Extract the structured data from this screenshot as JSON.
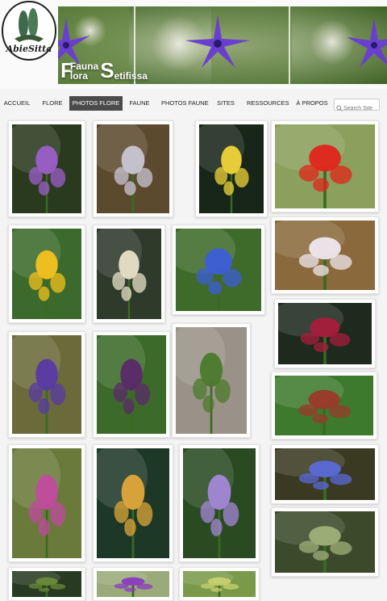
{
  "site": {
    "logo_text": "AbieSitta",
    "title_first_big": "F",
    "title_fauna": "Fauna",
    "title_flora": "lora",
    "title_second_big": "S",
    "title_setifissa": "etifissa"
  },
  "nav": {
    "items": [
      {
        "label": "ACCUEIL"
      },
      {
        "label": "FLORE"
      },
      {
        "label": "PHOTOS FLORE"
      },
      {
        "label": "FAUNE"
      },
      {
        "label": "PHOTOS FAUNE"
      },
      {
        "label": "SITES"
      },
      {
        "label": "RESSOURCES"
      },
      {
        "label": "À PROPOS"
      }
    ],
    "active_index": 2
  },
  "search": {
    "placeholder": "Search Site"
  },
  "colors": {
    "nav_active_bg": "#4b4b4b",
    "banner_green": "#4a6b2c",
    "flower_violet": "#6a3fd0"
  },
  "gallery": {
    "photos": [
      {
        "subject": "ophrys-orchid",
        "bg": "#2a3a1e",
        "accent": "#9b5fc9"
      },
      {
        "subject": "white-bud",
        "bg": "#5c4a2e",
        "accent": "#c9c6d4"
      },
      {
        "subject": "yellow-narcissus",
        "bg": "#18261a",
        "accent": "#f0d43a"
      },
      {
        "subject": "red-poppy",
        "bg": "#8aa05c",
        "accent": "#e0251a"
      },
      {
        "subject": "yellow-daisy",
        "bg": "#3c6a2c",
        "accent": "#f4c21e"
      },
      {
        "subject": "pale-bells",
        "bg": "#2e3a2a",
        "accent": "#e8e2c8"
      },
      {
        "subject": "blue-pimpernel",
        "bg": "#3e6a2a",
        "accent": "#3c5ed8"
      },
      {
        "subject": "white-papery",
        "bg": "#8a6a3c",
        "accent": "#efe7ee"
      },
      {
        "subject": "purple-sage",
        "bg": "#6a6a3a",
        "accent": "#5a3aa6"
      },
      {
        "subject": "purple-spikes",
        "bg": "#3c6a2a",
        "accent": "#5a2a6a"
      },
      {
        "subject": "orchid-in-leaves",
        "bg": "#9a9288",
        "accent": "#4a7a2a"
      },
      {
        "subject": "dark-red-berries",
        "bg": "#1e2a1e",
        "accent": "#a81e3c"
      },
      {
        "subject": "green-leaves-pod",
        "bg": "#3e7a2e",
        "accent": "#9a3a2a"
      },
      {
        "subject": "pink-orchid",
        "bg": "#6a7a3a",
        "accent": "#c24aa0"
      },
      {
        "subject": "yellow-orchid-stalk",
        "bg": "#1e3828",
        "accent": "#e0a63a"
      },
      {
        "subject": "lilac-flowers",
        "bg": "#2a4a22",
        "accent": "#a487d8"
      },
      {
        "subject": "blue-globes",
        "bg": "#3a3a22",
        "accent": "#5a6ad8"
      },
      {
        "subject": "cedar-cone",
        "bg": "#3a4a2a",
        "accent": "#a0b07a"
      },
      {
        "subject": "row5-left",
        "bg": "#283a22",
        "accent": "#6a8a3a"
      },
      {
        "subject": "row5-mid",
        "bg": "#9aaa7a",
        "accent": "#8a3ac0"
      },
      {
        "subject": "row5-right",
        "bg": "#7a9a4a",
        "accent": "#c8d070"
      }
    ]
  }
}
